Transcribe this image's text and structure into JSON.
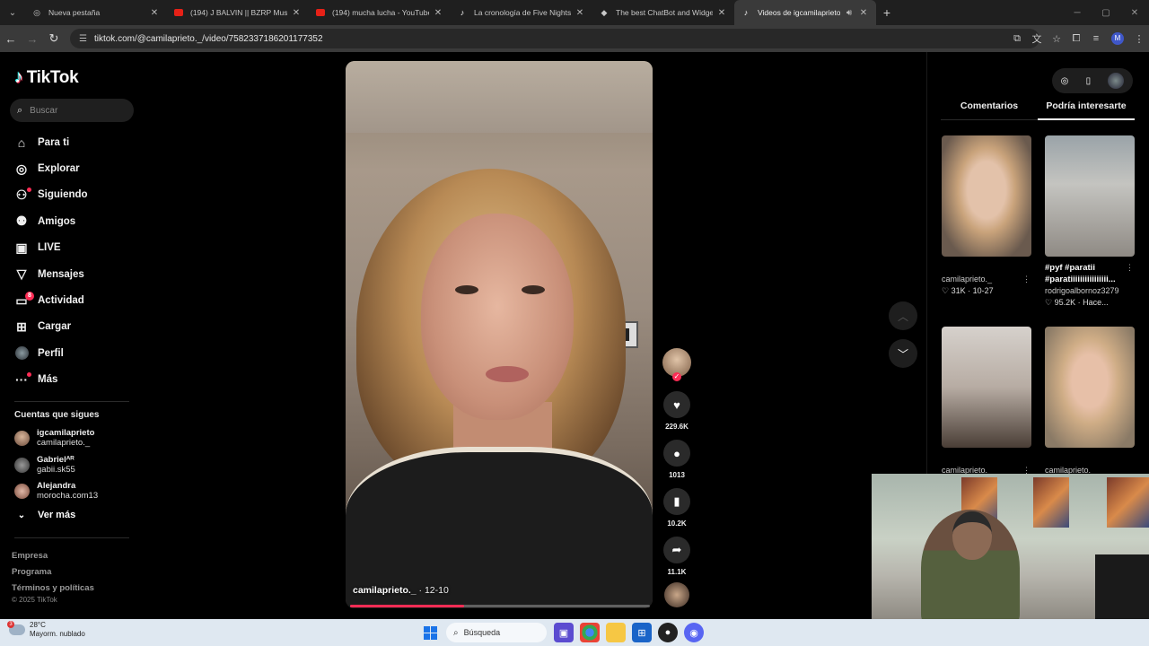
{
  "browser": {
    "tabs": [
      {
        "title": "Nueva pestaña",
        "icon": "globe-icon",
        "active": false
      },
      {
        "title": "(194) J BALVIN || BZRP Music Se",
        "icon": "youtube-icon",
        "active": false
      },
      {
        "title": "(194) mucha lucha - YouTube",
        "icon": "youtube-icon",
        "active": false
      },
      {
        "title": "La cronología de Five Nights at",
        "icon": "tiktok-icon",
        "active": false
      },
      {
        "title": "The best ChatBot and Widgets",
        "icon": "chatbot-icon",
        "active": false
      },
      {
        "title": "Videos de igcamilaprieto (@",
        "icon": "tiktok-icon",
        "active": true
      }
    ],
    "url": "tiktok.com/@camilaprieto._/video/7582337186201177352",
    "profile_initial": "M"
  },
  "sidebar": {
    "logo": "TikTok",
    "search_placeholder": "Buscar",
    "nav": [
      {
        "label": "Para ti",
        "icon": "home-icon"
      },
      {
        "label": "Explorar",
        "icon": "compass-icon"
      },
      {
        "label": "Siguiendo",
        "icon": "following-icon"
      },
      {
        "label": "Amigos",
        "icon": "friends-icon"
      },
      {
        "label": "LIVE",
        "icon": "live-icon"
      },
      {
        "label": "Mensajes",
        "icon": "messages-icon"
      },
      {
        "label": "Actividad",
        "icon": "activity-icon",
        "badge": "8"
      },
      {
        "label": "Cargar",
        "icon": "upload-icon"
      },
      {
        "label": "Perfil",
        "icon": "profile-icon"
      },
      {
        "label": "Más",
        "icon": "more-icon"
      }
    ],
    "following_title": "Cuentas que sigues",
    "following": [
      {
        "name": "igcamilaprieto",
        "handle": "camilaprieto._"
      },
      {
        "name": "Gabrielᴬᴿ",
        "handle": "gabii.sk55"
      },
      {
        "name": "Alejandra",
        "handle": "morocha.com13"
      }
    ],
    "see_more": "Ver más",
    "footer": [
      "Empresa",
      "Programa",
      "Términos y políticas"
    ],
    "copyright": "© 2025 TikTok"
  },
  "video": {
    "author": "camilaprieto._",
    "date": "12-10",
    "progress": 0.38
  },
  "actions": {
    "likes": "229.6K",
    "comments": "1013",
    "saves": "10.2K",
    "shares": "11.1K"
  },
  "right_panel": {
    "tabs": [
      "Comentarios",
      "Podría interesarte"
    ],
    "active_tab": 1,
    "items": [
      {
        "title": "",
        "author": "camilaprieto._",
        "likes": "31K",
        "date": "10-27"
      },
      {
        "title": "#pyf #paratii #paratiiiiiiiiiiiiiiii...",
        "author": "rodrigoalbornoz3279",
        "likes": "95.2K",
        "date": "Hace..."
      },
      {
        "title": "",
        "author": "camilaprieto._",
        "likes": "",
        "date": ""
      },
      {
        "title": "",
        "author": "camilaprieto._",
        "likes": "",
        "date": ""
      }
    ]
  },
  "taskbar": {
    "temp": "28°C",
    "weather": "Mayorm. nublado",
    "weather_badge": "3",
    "search": "Búsqueda"
  },
  "colors": {
    "accent": "#fe2c55",
    "background": "#000000"
  }
}
